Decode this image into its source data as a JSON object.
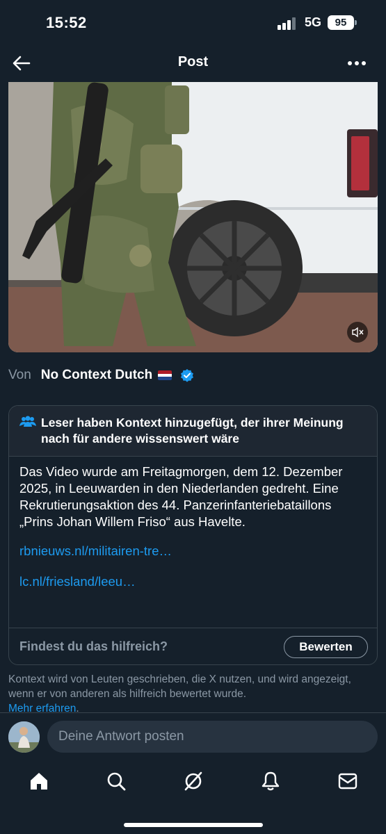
{
  "status": {
    "time": "15:52",
    "network": "5G",
    "battery": "95"
  },
  "header": {
    "title": "Post",
    "back_icon": "arrow-left-icon",
    "more_icon": "more-horizontal-icon"
  },
  "video": {
    "mute_icon": "speaker-muted-icon"
  },
  "source": {
    "prefix": "Von",
    "name": "No Context Dutch",
    "flag": "netherlands-flag",
    "verified_icon": "verified-badge-icon"
  },
  "note": {
    "title": "Leser haben Kontext hinzugefügt, der ihrer Meinung nach für andere wissenswert wäre",
    "body": "Das Video wurde am Freitagmorgen, dem 12. Dezember 2025, in Leeuwarden in den Niederlanden gedreht. Eine Rekrutierungsaktion des 44. Panzerinfanteriebataillons „Prins Johan Willem Friso“ aus Havelte.",
    "links": [
      "rbnieuws.nl/militairen-tre…",
      "lc.nl/friesland/leeu…"
    ],
    "question": "Findest du das hilfreich?",
    "rate_label": "Bewerten"
  },
  "disclaimer": {
    "text": "Kontext wird von Leuten geschrieben, die X nutzen, und wird angezeigt, wenn er von anderen als hilfreich bewertet wurde.",
    "learn_more": "Mehr erfahren",
    "learn_more_suffix": "."
  },
  "reply": {
    "placeholder": "Deine Antwort posten"
  },
  "nav": {
    "items": [
      "home-icon",
      "search-icon",
      "grok-icon",
      "notifications-icon",
      "messages-icon"
    ]
  },
  "colors": {
    "background": "#15202b",
    "accent": "#1d9bf0",
    "muted": "#8b98a5",
    "border": "#38444d"
  }
}
